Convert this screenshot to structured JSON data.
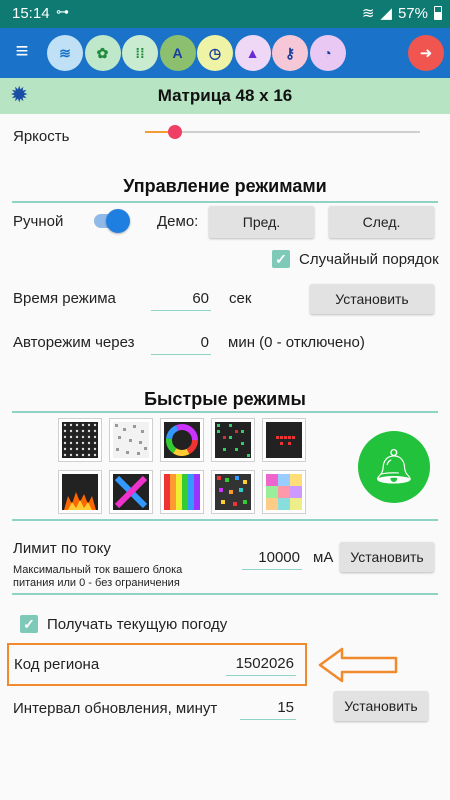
{
  "status": {
    "time": "15:14",
    "battery": "57%"
  },
  "toolbar": {
    "modes": [
      {
        "icon": "wifi-icon",
        "glyph": "≋",
        "bg": "#bfe0f5",
        "fg": "#1a73c9"
      },
      {
        "icon": "gear-small-icon",
        "glyph": "✿",
        "bg": "#bfe7c9",
        "fg": "#1f8a3a"
      },
      {
        "icon": "grid-dots-icon",
        "glyph": "⁞⁞",
        "bg": "#c9ebcf",
        "fg": "#1f8a3a"
      },
      {
        "icon": "text-a-icon",
        "glyph": "A",
        "bg": "#8cc06f",
        "fg": "#1a3f9a"
      },
      {
        "icon": "clock-icon",
        "glyph": "◷",
        "bg": "#eef3a6",
        "fg": "#1a3f9a"
      },
      {
        "icon": "bell-small-icon",
        "glyph": "▲",
        "bg": "#efd8f6",
        "fg": "#6a2ad4"
      },
      {
        "icon": "key-icon",
        "glyph": "⚷",
        "bg": "#f6c7d6",
        "fg": "#1a3f9a"
      },
      {
        "icon": "stopwatch-icon",
        "glyph": "◔",
        "bg": "#e9c9f3",
        "fg": "#1a3f9a"
      }
    ]
  },
  "header": {
    "title": "Матрица 48 x 16"
  },
  "brightness": {
    "label": "Яркость",
    "value_fraction": 0.11
  },
  "modes_control": {
    "heading": "Управление режимами",
    "manual_label": "Ручной",
    "demo_label": "Демо:",
    "prev_label": "Пред.",
    "next_label": "След.",
    "random_label": "Случайный порядок",
    "mode_time_label": "Время режима",
    "mode_time_value": "60",
    "mode_time_unit": "сек",
    "set_label": "Установить",
    "auto_label": "Авторежим через",
    "auto_value": "0",
    "auto_unit": "мин (0 - отключено)"
  },
  "quick_modes": {
    "heading": "Быстрые режимы"
  },
  "current_limit": {
    "label": "Лимит по току",
    "desc_line1": "Максимальный ток вашего блока",
    "desc_line2": "питания или 0 - без ограничения",
    "value": "10000",
    "unit": "мА",
    "set_label": "Установить"
  },
  "weather": {
    "get_label": "Получать текущую погоду",
    "region_label": "Код региона",
    "region_value": "1502026",
    "interval_label": "Интервал обновления, минут",
    "interval_value": "15",
    "set_label": "Установить"
  },
  "colors": {
    "accent": "#1a73c9",
    "divider": "#8fd3c5",
    "highlight": "#f08a2c",
    "bell": "#22c23c"
  }
}
